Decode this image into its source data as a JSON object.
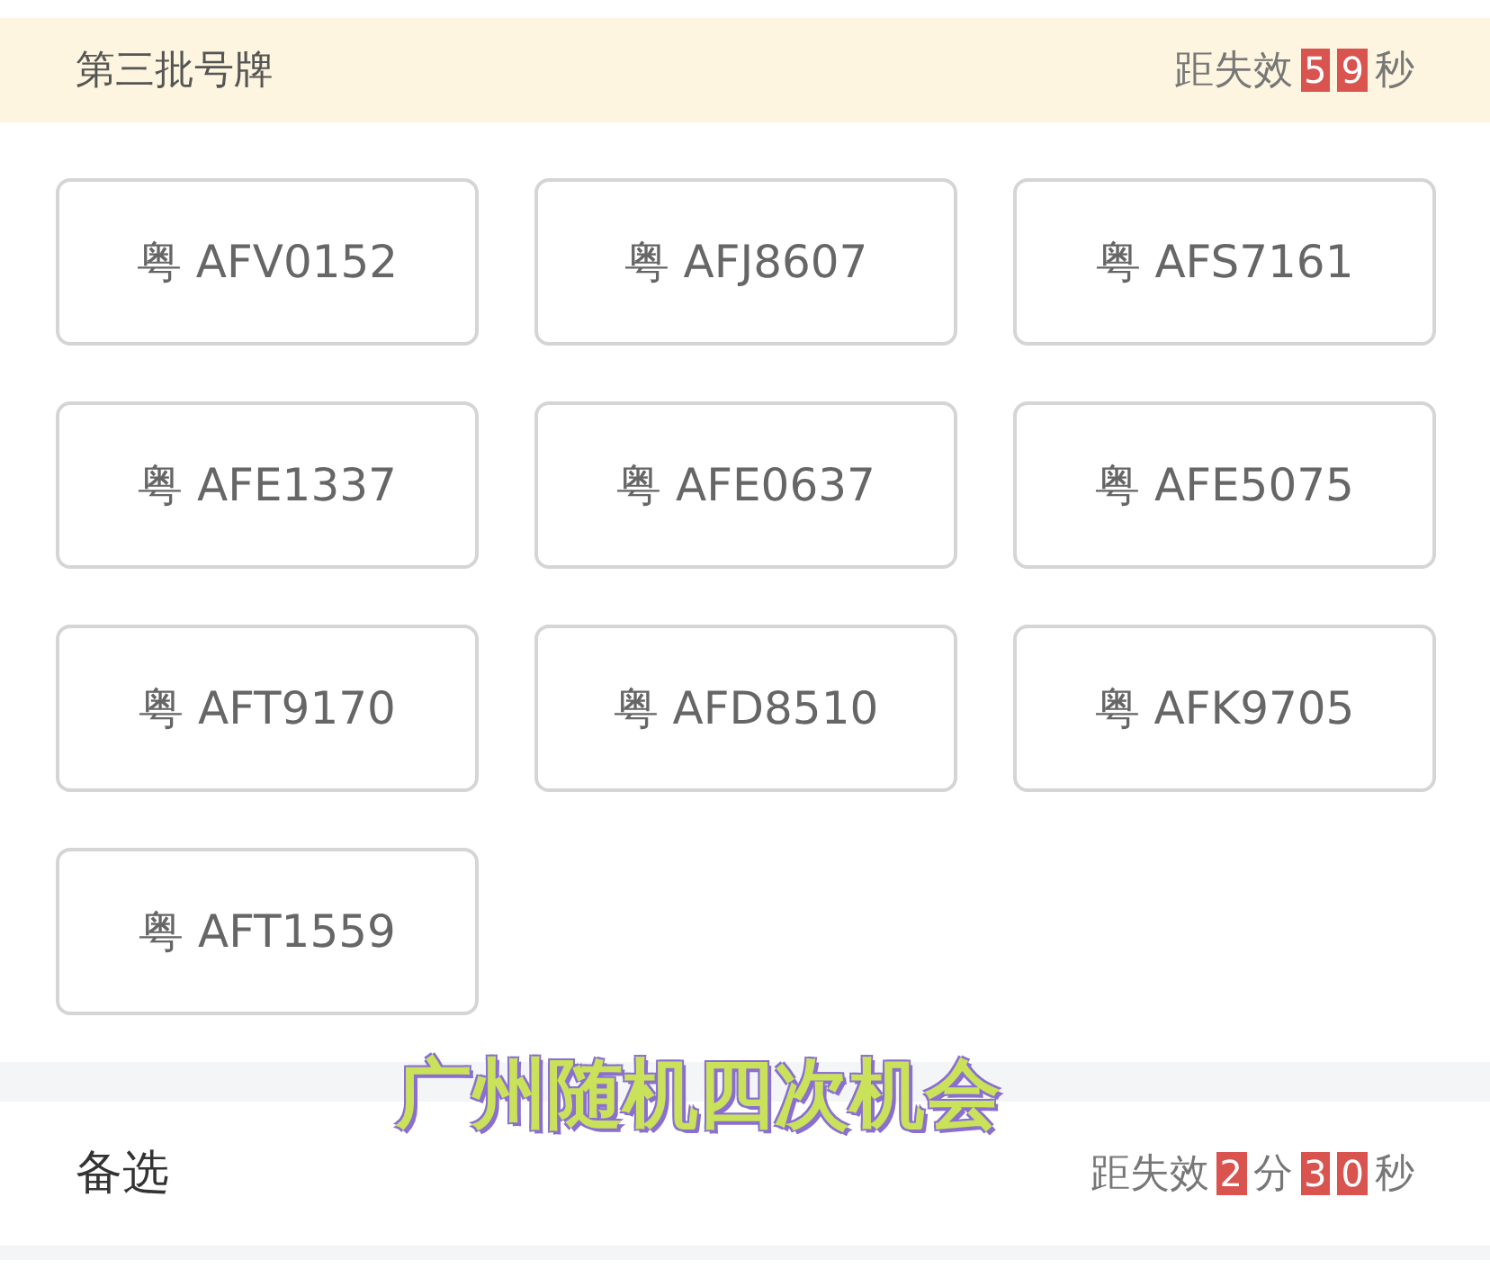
{
  "batch": {
    "title": "第三批号牌",
    "countdown": [
      {
        "kind": "label",
        "text": "距失效"
      },
      {
        "kind": "digit",
        "text": "5"
      },
      {
        "kind": "digit",
        "text": "9"
      },
      {
        "kind": "label",
        "text": "秒"
      }
    ]
  },
  "plates": [
    "粤 AFV0152",
    "粤 AFJ8607",
    "粤 AFS7161",
    "粤 AFE1337",
    "粤 AFE0637",
    "粤 AFE5075",
    "粤 AFT9170",
    "粤 AFD8510",
    "粤 AFK9705",
    "粤 AFT1559"
  ],
  "caption": "广州随机四次机会",
  "alternate": {
    "title": "备选",
    "countdown": [
      {
        "kind": "label",
        "text": "距失效"
      },
      {
        "kind": "digit",
        "text": "2"
      },
      {
        "kind": "label",
        "text": "分"
      },
      {
        "kind": "digit",
        "text": "3"
      },
      {
        "kind": "digit",
        "text": "0"
      },
      {
        "kind": "label",
        "text": "秒"
      }
    ]
  }
}
